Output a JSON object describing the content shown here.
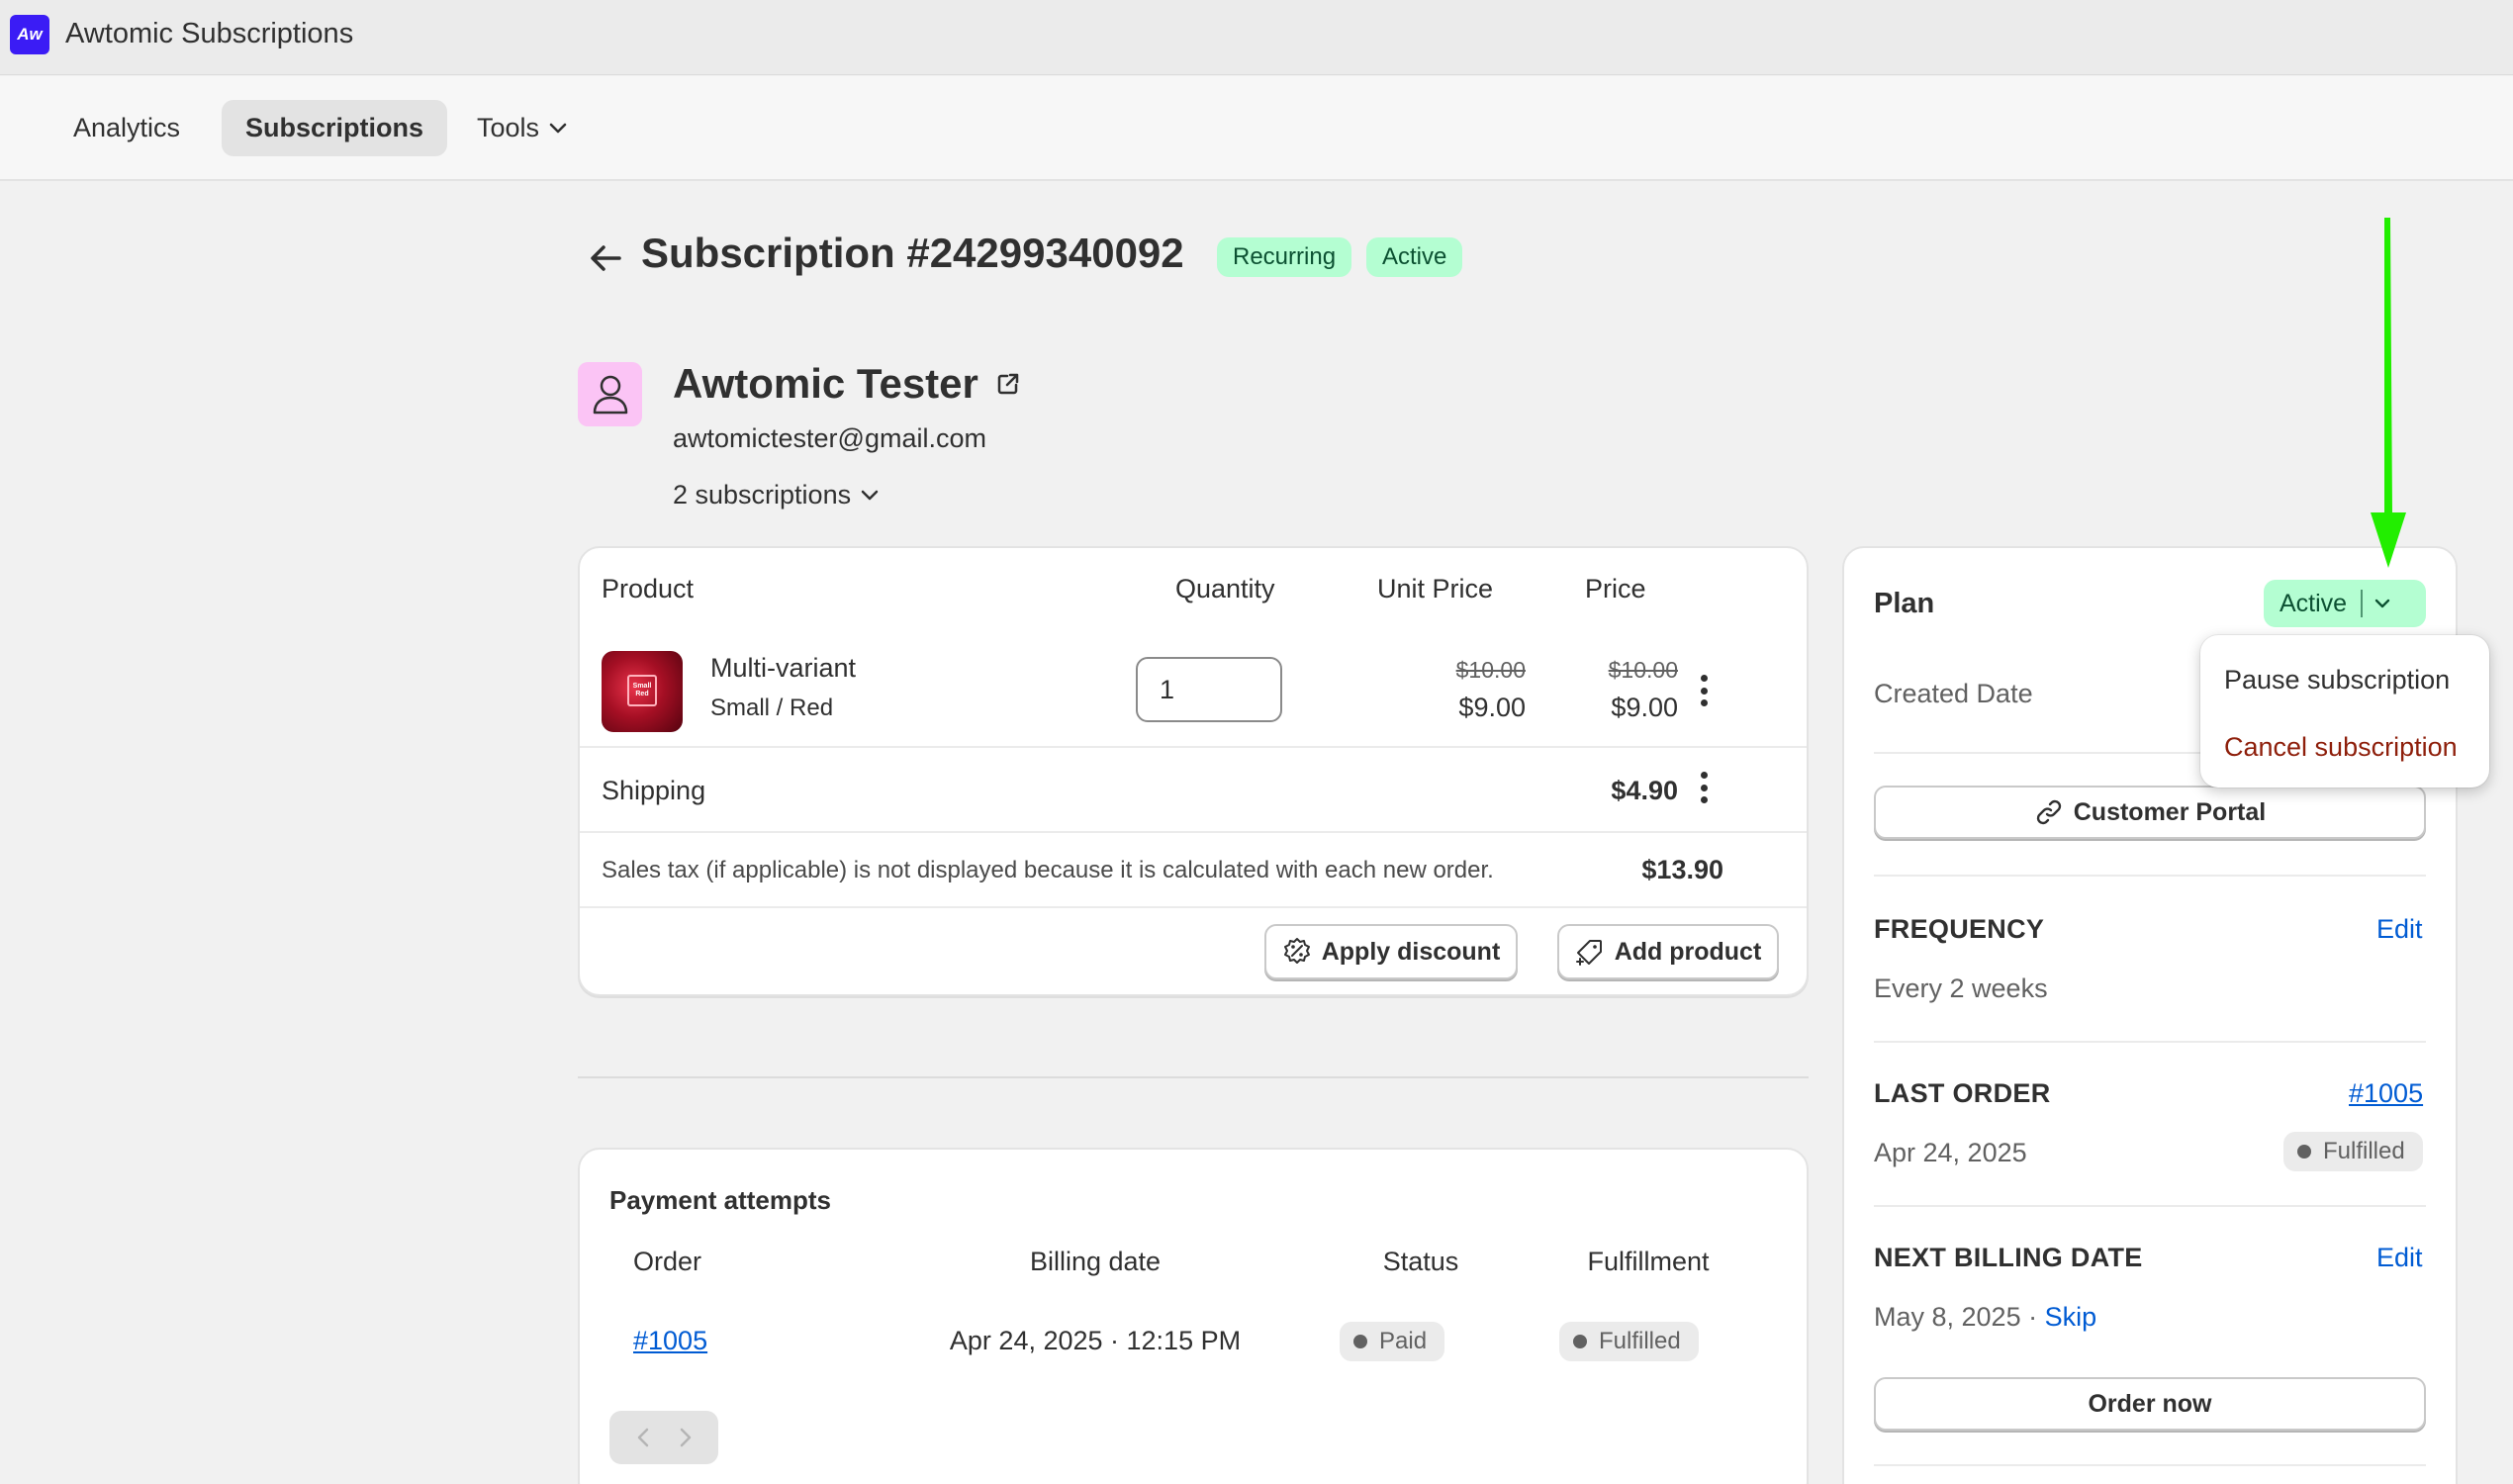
{
  "app": {
    "logo_text": "Aw",
    "title": "Awtomic Subscriptions"
  },
  "nav": {
    "analytics": "Analytics",
    "subscriptions": "Subscriptions",
    "tools": "Tools"
  },
  "header": {
    "title": "Subscription #24299340092",
    "badges": [
      "Recurring",
      "Active"
    ]
  },
  "customer": {
    "name": "Awtomic Tester",
    "email": "awtomictester@gmail.com",
    "subscriptions_label": "2 subscriptions"
  },
  "products": {
    "columns": {
      "product": "Product",
      "quantity": "Quantity",
      "unit_price": "Unit Price",
      "price": "Price"
    },
    "item": {
      "thumb_text": "Small Red",
      "name": "Multi-variant",
      "variant": "Small / Red",
      "quantity": "1",
      "unit_price_original": "$10.00",
      "unit_price": "$9.00",
      "price_original": "$10.00",
      "price": "$9.00"
    },
    "shipping": {
      "label": "Shipping",
      "amount": "$4.90"
    },
    "tax_note": "Sales tax (if applicable) is not displayed because it is calculated with each new order.",
    "total": "$13.90",
    "apply_discount": "Apply discount",
    "add_product": "Add product"
  },
  "payments": {
    "title": "Payment attempts",
    "columns": {
      "order": "Order",
      "billing_date": "Billing date",
      "status": "Status",
      "fulfillment": "Fulfillment"
    },
    "rows": [
      {
        "order": "#1005",
        "billing_date": "Apr 24, 2025 · 12:15 PM",
        "status": "Paid",
        "fulfillment": "Fulfilled"
      }
    ]
  },
  "plan": {
    "title": "Plan",
    "status": "Active",
    "created_label": "Created Date",
    "customer_portal": "Customer Portal",
    "frequency": {
      "title": "FREQUENCY",
      "edit": "Edit",
      "value": "Every 2 weeks"
    },
    "last_order": {
      "title": "LAST ORDER",
      "order": "#1005",
      "date": "Apr 24, 2025",
      "status": "Fulfilled"
    },
    "next_billing": {
      "title": "NEXT BILLING DATE",
      "edit": "Edit",
      "date": "May 8, 2025 ·",
      "skip": "Skip",
      "order_now": "Order now"
    }
  },
  "dropdown": {
    "pause": "Pause subscription",
    "cancel": "Cancel subscription"
  },
  "colors": {
    "brand": "#3b1cf5",
    "success_bg": "#b4fed2",
    "success_text": "#0c5132",
    "link": "#005bd3",
    "danger": "#8e1f0b",
    "annotation": "#22ee00"
  }
}
